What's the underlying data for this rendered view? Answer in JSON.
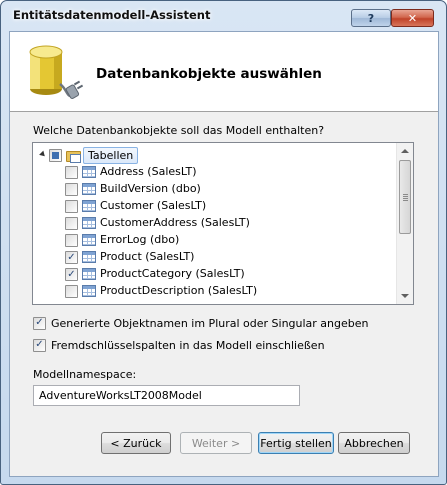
{
  "window": {
    "title": "Entitätsdatenmodell-Assistent",
    "help_label": "?",
    "close_label": "✕"
  },
  "banner": {
    "icon": "database-plug-icon",
    "title": "Datenbankobjekte auswählen"
  },
  "question": "Welche Datenbankobjekte soll das Modell enthalten?",
  "tree": {
    "root": {
      "label": "Tabellen",
      "state": "partial",
      "expanded": true
    },
    "items": [
      {
        "label": "Address (SalesLT)",
        "checked": false
      },
      {
        "label": "BuildVersion (dbo)",
        "checked": false
      },
      {
        "label": "Customer (SalesLT)",
        "checked": false
      },
      {
        "label": "CustomerAddress (SalesLT)",
        "checked": false
      },
      {
        "label": "ErrorLog (dbo)",
        "checked": false
      },
      {
        "label": "Product (SalesLT)",
        "checked": true
      },
      {
        "label": "ProductCategory (SalesLT)",
        "checked": true
      },
      {
        "label": "ProductDescription (SalesLT)",
        "checked": false
      }
    ]
  },
  "options": {
    "pluralize": {
      "label": "Generierte Objektnamen im Plural oder Singular angeben",
      "checked": true
    },
    "foreign_keys": {
      "label": "Fremdschlüsselspalten in das Modell einschließen",
      "checked": true
    }
  },
  "namespace": {
    "label": "Modellnamespace:",
    "value": "AdventureWorksLT2008Model"
  },
  "buttons": {
    "back": "< Zurück",
    "next": "Weiter >",
    "finish": "Fertig stellen",
    "cancel": "Abbrechen"
  },
  "colors": {
    "titlebar": "#c6d9ee",
    "close": "#c0432a",
    "selection": "#dbe9fa"
  }
}
